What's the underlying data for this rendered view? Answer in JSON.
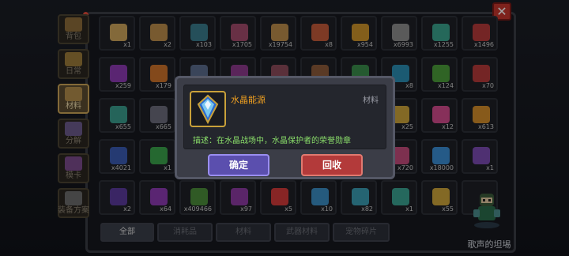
{
  "side_tabs": [
    {
      "label": "背包",
      "icon": "backpack-icon"
    },
    {
      "label": "日常",
      "icon": "chest-icon"
    },
    {
      "label": "材料",
      "icon": "material-icon",
      "active": true
    },
    {
      "label": "分解",
      "icon": "decompose-icon"
    },
    {
      "label": "模卡",
      "icon": "card-icon"
    },
    {
      "label": "装备方案",
      "icon": "equipment-plan-icon"
    }
  ],
  "grid": {
    "rows": [
      [
        {
          "icon": "sword-item-icon",
          "qty": "x1",
          "color": "#c9a15a"
        },
        {
          "icon": "hammer-item-icon",
          "qty": "x2",
          "color": "#b98a4a"
        },
        {
          "icon": "jar-item-icon",
          "qty": "x103",
          "color": "#3a7a8a"
        },
        {
          "icon": "crystal-red-item-icon",
          "qty": "x1705",
          "color": "#a04a6a"
        },
        {
          "icon": "frame-item-icon",
          "qty": "x19754",
          "color": "#b98a4a"
        },
        {
          "icon": "meat-item-icon",
          "qty": "x8",
          "color": "#c05a3a"
        },
        {
          "icon": "bread-item-icon",
          "qty": "x954",
          "color": "#c9912a"
        },
        {
          "icon": "ore-item-icon",
          "qty": "x6993",
          "color": "#8a8a8a"
        },
        {
          "icon": "gem-teal-item-icon",
          "qty": "x1255",
          "color": "#3aa08a"
        },
        {
          "icon": "scroll-red-item-icon",
          "qty": "x1496",
          "color": "#b33a3a"
        }
      ],
      [
        {
          "icon": "potion-purple-item-icon",
          "qty": "x259",
          "color": "#8a3ab0"
        },
        {
          "icon": "orb-orange-item-icon",
          "qty": "x179",
          "color": "#c9702a"
        },
        {
          "icon": "shard-item-icon",
          "qty": "",
          "color": "#5a6a8a"
        },
        {
          "icon": "box-item-icon",
          "qty": "",
          "color": "#8a3a8a"
        },
        {
          "icon": "bear-item-icon",
          "qty": "",
          "color": "#8a4a5a"
        },
        {
          "icon": "bear-brown-item-icon",
          "qty": "",
          "color": "#8a5a3a"
        },
        {
          "icon": "leaf-item-icon",
          "qty": "",
          "color": "#3a8a4a"
        },
        {
          "icon": "gem-cyan-item-icon",
          "qty": "x8",
          "color": "#2a8ab0"
        },
        {
          "icon": "orb-green-item-icon",
          "qty": "x124",
          "color": "#4a9a3a"
        },
        {
          "icon": "shield-red-item-icon",
          "qty": "x70",
          "color": "#b33a3a"
        }
      ],
      [
        {
          "icon": "crystal-cluster-item-icon",
          "qty": "x655",
          "color": "#3a9a8a"
        },
        {
          "icon": "lantern-item-icon",
          "qty": "x665",
          "color": "#6a6a7a"
        },
        {
          "icon": "",
          "qty": "",
          "color": ""
        },
        {
          "icon": "",
          "qty": "",
          "color": ""
        },
        {
          "icon": "",
          "qty": "",
          "color": ""
        },
        {
          "icon": "",
          "qty": "",
          "color": ""
        },
        {
          "icon": "",
          "qty": "",
          "color": ""
        },
        {
          "icon": "crystal-gold-item-icon",
          "qty": "x25",
          "color": "#c9a13a"
        },
        {
          "icon": "crystal-pink-item-icon",
          "qty": "x12",
          "color": "#d04a8a"
        },
        {
          "icon": "crystal-amber-item-icon",
          "qty": "x613",
          "color": "#d08a2a"
        }
      ],
      [
        {
          "icon": "crystal-blue-item-icon",
          "qty": "x4021",
          "color": "#3a5ab0"
        },
        {
          "icon": "emerald-item-icon",
          "qty": "x1",
          "color": "#3aa04a"
        },
        {
          "icon": "",
          "qty": "",
          "color": ""
        },
        {
          "icon": "",
          "qty": "",
          "color": ""
        },
        {
          "icon": "",
          "qty": "",
          "color": ""
        },
        {
          "icon": "",
          "qty": "",
          "color": ""
        },
        {
          "icon": "",
          "qty": "",
          "color": ""
        },
        {
          "icon": "flower-pink-item-icon",
          "qty": "x720",
          "color": "#c04a7a"
        },
        {
          "icon": "crystal-energy-item-icon",
          "qty": "x18000",
          "color": "#3a8ad0"
        },
        {
          "icon": "crystal-violet-item-icon",
          "qty": "x1",
          "color": "#7a4ab0"
        }
      ],
      [
        {
          "icon": "crystal-dark-item-icon",
          "qty": "x2",
          "color": "#5a3a9a"
        },
        {
          "icon": "imp-item-icon",
          "qty": "x64",
          "color": "#8a3ab0"
        },
        {
          "icon": "coin-green-item-icon",
          "qty": "x409466",
          "color": "#4a8a3a"
        },
        {
          "icon": "mask-purple-item-icon",
          "qty": "x97",
          "color": "#8a3aa0"
        },
        {
          "icon": "heart-item-icon",
          "qty": "x5",
          "color": "#d03a3a"
        },
        {
          "icon": "beads-item-icon",
          "qty": "x10",
          "color": "#3a8ac0"
        },
        {
          "icon": "blocks-item-icon",
          "qty": "x82",
          "color": "#3a9ab0"
        },
        {
          "icon": "cone-item-icon",
          "qty": "x1",
          "color": "#3aa090"
        },
        {
          "icon": "badge-gold-item-icon",
          "qty": "x55",
          "color": "#c9a13a"
        },
        {
          "icon": "",
          "qty": "",
          "color": ""
        }
      ]
    ]
  },
  "filters": [
    "全部",
    "消耗品",
    "材料",
    "武器材料",
    "宠物碎片"
  ],
  "character_label": "歌声的坦埸",
  "modal": {
    "item_name": "水晶能源",
    "item_type": "材料",
    "description": "描述：在水晶战场中，水晶保护者的荣誉勋章",
    "confirm_label": "确定",
    "recycle_label": "回收",
    "item_icon": "crystal-energy-icon"
  },
  "close_label": "✕",
  "colors": {
    "name_orange": "#f0a020",
    "desc_green": "#8be06a",
    "confirm_purple": "#5b4fae",
    "recycle_red": "#b33a3a",
    "close_red": "#c2352c"
  }
}
